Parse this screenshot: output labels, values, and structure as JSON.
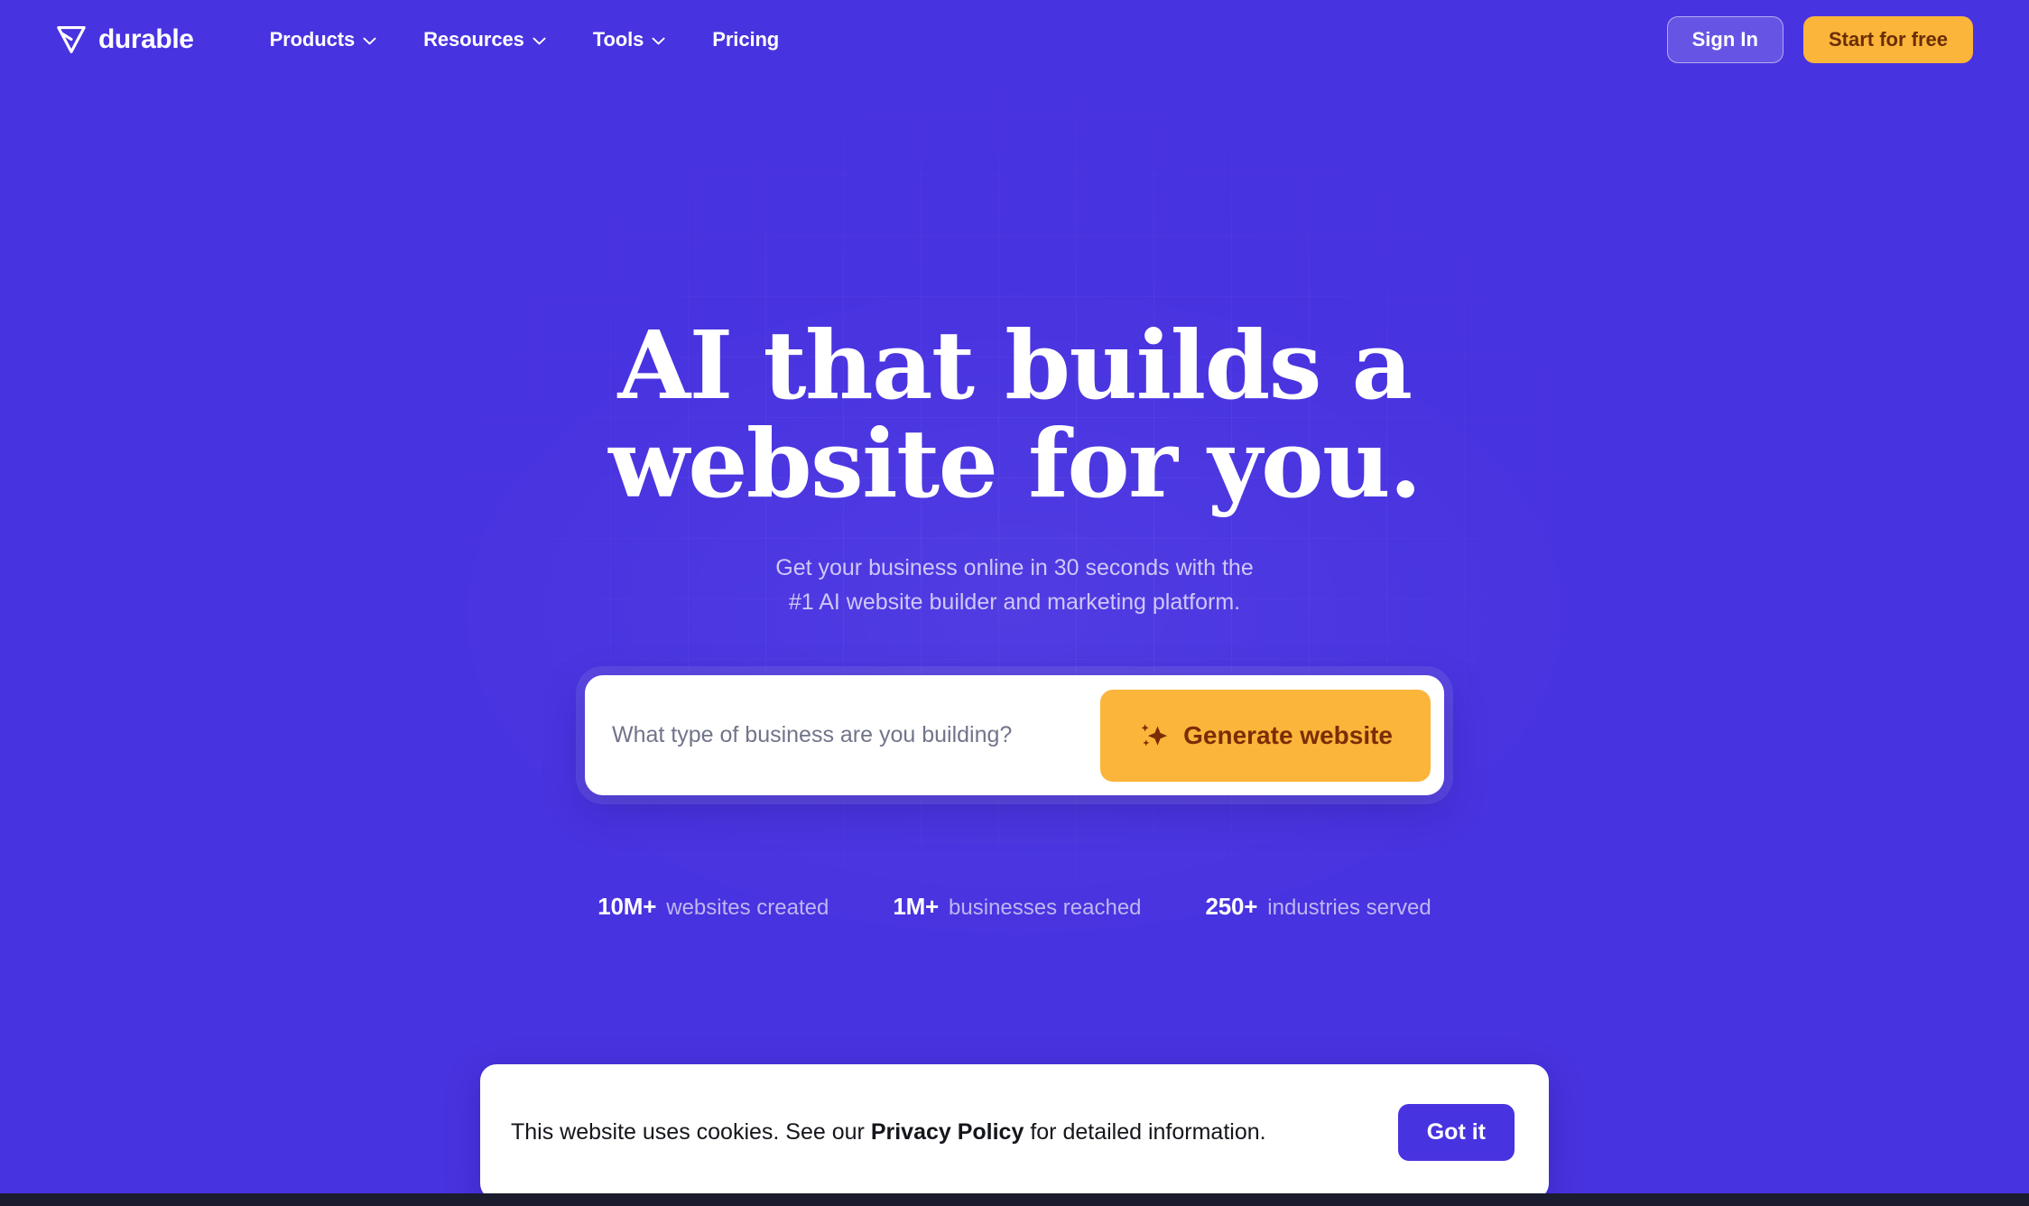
{
  "brand": {
    "name": "durable",
    "logo_icon": "diamond-gem-icon"
  },
  "nav": {
    "items": [
      {
        "label": "Products",
        "has_dropdown": true
      },
      {
        "label": "Resources",
        "has_dropdown": true
      },
      {
        "label": "Tools",
        "has_dropdown": true
      },
      {
        "label": "Pricing",
        "has_dropdown": false
      }
    ],
    "sign_in_label": "Sign In",
    "start_free_label": "Start for free"
  },
  "hero": {
    "title_line1": "AI that builds a",
    "title_line2": "website for you.",
    "subtitle_line1": "Get your business online in 30 seconds with the",
    "subtitle_line2": "#1 AI website builder and marketing platform."
  },
  "generator": {
    "input_value": "",
    "input_placeholder": "What type of business are you building?",
    "button_label": "Generate website",
    "button_icon": "sparkle-icon"
  },
  "stats": [
    {
      "value": "10M+",
      "label": "websites created"
    },
    {
      "value": "1M+",
      "label": "businesses reached"
    },
    {
      "value": "250+",
      "label": "industries served"
    }
  ],
  "cookie_banner": {
    "text_before": "This website uses cookies. See our ",
    "link_label": "Privacy Policy",
    "text_after": " for detailed information.",
    "accept_label": "Got it"
  },
  "colors": {
    "background": "#4833E0",
    "accent_yellow": "#FBB53A",
    "accent_yellow_text": "#7A2D06",
    "subtitle": "#CFC7F7",
    "stat_label": "#BFB6F2",
    "cookie_button": "#4833E0"
  }
}
